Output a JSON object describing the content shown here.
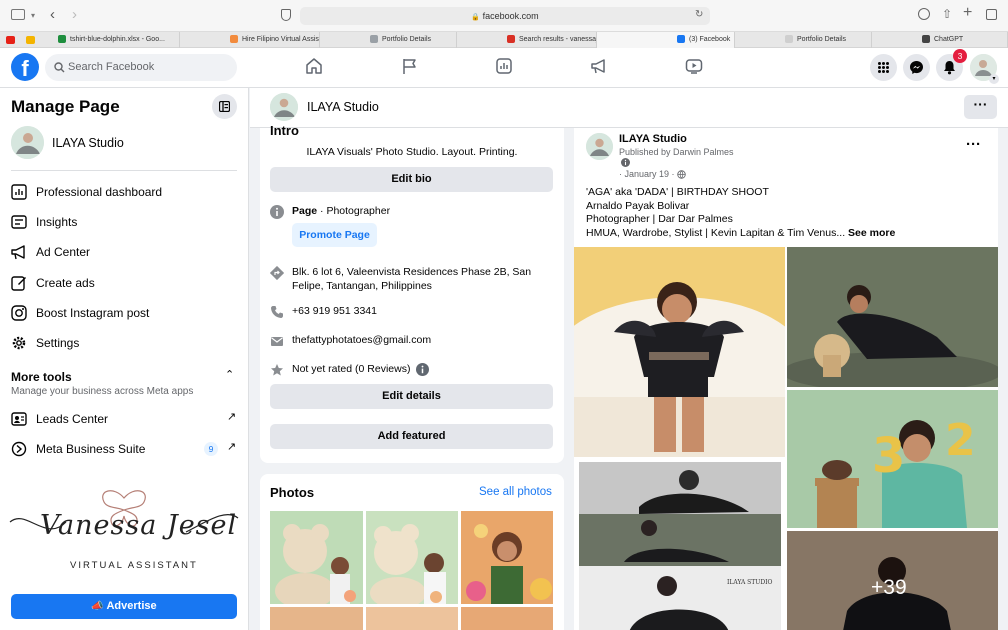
{
  "browser": {
    "url": "facebook.com",
    "tabs": [
      {
        "title": "tshirt-blue-dolphin.xlsx - Goo...",
        "color": "#1e8e3e"
      },
      {
        "title": "Hire Filipino Virtual Assistants...",
        "color": "#f28b3d"
      },
      {
        "title": "Portfolio Details",
        "color": "#9aa0a6"
      },
      {
        "title": "Search results - vanessajesel...",
        "color": "#d93025"
      },
      {
        "title": "(3) Facebook",
        "color": "#1877f2"
      },
      {
        "title": "Portfolio Details",
        "color": "#cfcfcf"
      },
      {
        "title": "ChatGPT",
        "color": "#444444"
      }
    ]
  },
  "header": {
    "search_placeholder": "Search Facebook",
    "notification_count": "3"
  },
  "sidebar": {
    "title": "Manage Page",
    "page_name": "ILAYA Studio",
    "items": [
      {
        "label": "Professional dashboard",
        "icon": "dashboard-icon"
      },
      {
        "label": "Insights",
        "icon": "insights-icon"
      },
      {
        "label": "Ad Center",
        "icon": "megaphone-icon"
      },
      {
        "label": "Create ads",
        "icon": "edit-icon"
      },
      {
        "label": "Boost Instagram post",
        "icon": "instagram-icon"
      },
      {
        "label": "Settings",
        "icon": "gear-icon"
      }
    ],
    "more_tools_title": "More tools",
    "more_tools_subtitle": "Manage your business across Meta apps",
    "tools": [
      {
        "label": "Leads Center",
        "badge": ""
      },
      {
        "label": "Meta Business Suite",
        "badge": "9"
      }
    ],
    "advertise_label": "Advertise"
  },
  "watermark": {
    "script_name": "Vanessa Jesel",
    "tagline": "VIRTUAL ASSISTANT"
  },
  "page_header": {
    "name": "ILAYA Studio"
  },
  "intro": {
    "title": "Intro",
    "bio": "ILAYA Visuals' Photo Studio. Layout. Printing.",
    "edit_bio_label": "Edit bio",
    "page_label": "Page",
    "page_category": " · Photographer",
    "promote_label": "Promote Page",
    "address": "Blk. 6 lot 6, Valeenvista Residences Phase 2B, San Felipe, Tantangan, Philippines",
    "phone": "+63 919 951 3341",
    "email": "thefattyphotatoes@gmail.com",
    "rating": "Not yet rated (0 Reviews)",
    "edit_details_label": "Edit details",
    "add_featured_label": "Add featured"
  },
  "photos": {
    "title": "Photos",
    "see_all_label": "See all photos"
  },
  "post": {
    "author": "ILAYA Studio",
    "published_by": "Published by Darwin Palmes",
    "date": "· January 19 ·",
    "lines": [
      "'AGA' aka 'DADA' | BIRTHDAY SHOOT",
      "Arnaldo Payak Bolivar",
      "Photographer | Dar Dar Palmes",
      "HMUA, Wardrobe, Stylist | Kevin Lapitan & Tim Venus... "
    ],
    "see_more_label": "See more",
    "more_count": "+39",
    "photo_logo": "ILAYA STUDIO"
  }
}
